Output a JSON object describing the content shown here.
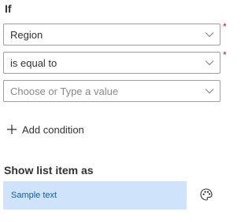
{
  "condition": {
    "if_label": "If",
    "field_select": {
      "value": "Region",
      "required_mark": "*"
    },
    "operator_select": {
      "value": "is equal to",
      "required_mark": "*"
    },
    "value_select": {
      "placeholder": "Choose or Type a value"
    },
    "add_condition_label": "Add condition"
  },
  "show_as": {
    "label": "Show list item as",
    "sample_text": "Sample text",
    "sample_background": "#cfe4fa",
    "sample_text_color": "#0f5da8"
  },
  "icons": {
    "dropdown": "chevron-down-icon",
    "add": "plus-icon",
    "format": "palette-icon"
  }
}
